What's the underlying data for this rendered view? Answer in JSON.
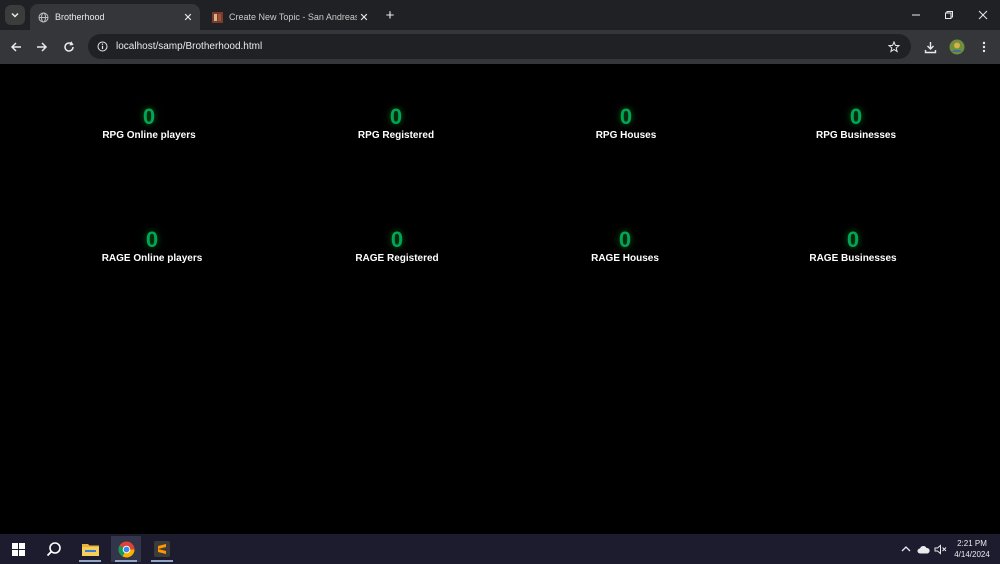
{
  "browser": {
    "tabs": [
      {
        "title": "Brotherhood",
        "active": true,
        "favicon": "globe-icon"
      },
      {
        "title": "Create New Topic - San Andreas",
        "active": false,
        "favicon": "forum-favicon-icon"
      }
    ],
    "url": "localhost/samp/Brotherhood.html"
  },
  "stats": {
    "rpg_online": {
      "value": "0",
      "label": "RPG Online players"
    },
    "rpg_registered": {
      "value": "0",
      "label": "RPG Registered"
    },
    "rpg_houses": {
      "value": "0",
      "label": "RPG Houses"
    },
    "rpg_businesses": {
      "value": "0",
      "label": "RPG Businesses"
    },
    "rage_online": {
      "value": "0",
      "label": "RAGE Online players"
    },
    "rage_registered": {
      "value": "0",
      "label": "RAGE Registered"
    },
    "rage_houses": {
      "value": "0",
      "label": "RAGE Houses"
    },
    "rage_businesses": {
      "value": "0",
      "label": "RAGE Businesses"
    }
  },
  "colors": {
    "stat_number": "#00a651",
    "page_background": "#000000",
    "taskbar": "#1c1c2e"
  },
  "taskbar": {
    "time": "2:21 PM",
    "date": "4/14/2024"
  }
}
